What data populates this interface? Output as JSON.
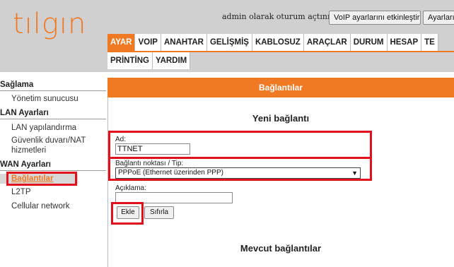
{
  "header": {
    "logo_text": "tılgın",
    "admin_text": "admin olarak oturum açtınız.",
    "voip_button": "VoIP ayarlarını etkinleştir",
    "settings_button": "Ayarları"
  },
  "nav": {
    "row1": [
      "AYAR",
      "VOIP",
      "ANAHTAR",
      "GELİŞMİŞ",
      "KABLOSUZ",
      "ARAÇLAR",
      "DURUM",
      "HESAP",
      "TE"
    ],
    "row2": [
      "PRİNTİNG",
      "YARDIM"
    ],
    "active": "AYAR"
  },
  "sidebar": {
    "sections": [
      {
        "heading": "Sağlama",
        "items": [
          "Yönetim sunucusu"
        ]
      },
      {
        "heading": "LAN Ayarları",
        "items": [
          "LAN yapılandırma",
          "Güvenlik duvarı/NAT",
          "hizmetleri"
        ]
      },
      {
        "heading": "WAN Ayarları",
        "items": [
          "Bağlantılar",
          "L2TP",
          "Cellular network"
        ]
      }
    ],
    "selected": "Bağlantılar"
  },
  "content": {
    "bar_title": "Bağlantılar",
    "new_connection_title": "Yeni bağlantı",
    "ad_label": "Ad:",
    "ad_value": "TTNET",
    "connection_point_label": "Bağlantı noktası / Tip:",
    "connection_point_value": "PPPoE (Ethernet üzerinden PPP)",
    "description_label": "Açıklama:",
    "description_value": "",
    "add_button": "Ekle",
    "reset_button": "Sıfırla",
    "existing_connections_title": "Mevcut bağlantılar"
  },
  "colors": {
    "accent": "#f07a24",
    "header_bg": "#d0d0d0",
    "highlight": "#e0101c"
  }
}
